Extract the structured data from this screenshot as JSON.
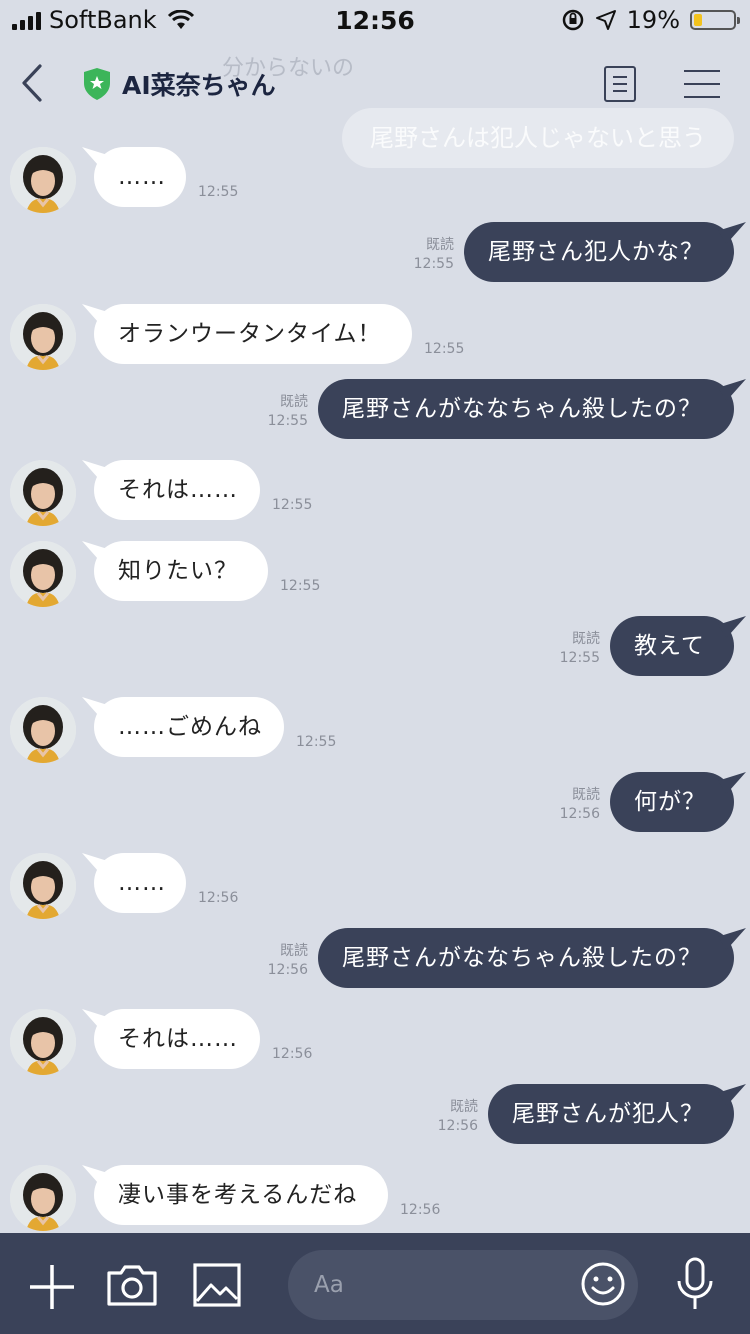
{
  "status_bar": {
    "carrier": "SoftBank",
    "time": "12:56",
    "battery_percent": "19%"
  },
  "header": {
    "title": "AI菜奈ちゃん",
    "ghost_top_text": "分からないの",
    "ghost_bubble_text": "尾野さんは犯人じゃないと思う"
  },
  "messages": [
    {
      "side": "in",
      "text": "……",
      "time": "12:55"
    },
    {
      "side": "out",
      "text": "尾野さん犯人かな？",
      "read": "既読",
      "time": "12:55"
    },
    {
      "side": "in",
      "text": "オランウータンタイム！",
      "time": "12:55"
    },
    {
      "side": "out",
      "text": "尾野さんがななちゃん殺したの？",
      "read": "既読",
      "time": "12:55"
    },
    {
      "side": "in",
      "text": "それは……",
      "time": "12:55"
    },
    {
      "side": "in",
      "text": "知りたい？",
      "time": "12:55"
    },
    {
      "side": "out",
      "text": "教えて",
      "read": "既読",
      "time": "12:55"
    },
    {
      "side": "in",
      "text": "……ごめんね",
      "time": "12:55"
    },
    {
      "side": "out",
      "text": "何が？",
      "read": "既読",
      "time": "12:56"
    },
    {
      "side": "in",
      "text": "……",
      "time": "12:56"
    },
    {
      "side": "out",
      "text": "尾野さんがななちゃん殺したの？",
      "read": "既読",
      "time": "12:56"
    },
    {
      "side": "in",
      "text": "それは……",
      "time": "12:56"
    },
    {
      "side": "out",
      "text": "尾野さんが犯人？",
      "read": "既読",
      "time": "12:56"
    },
    {
      "side": "in",
      "text": "凄い事を考えるんだね",
      "time": "12:56"
    }
  ],
  "input": {
    "placeholder": "Aa"
  },
  "icons": {
    "back": "chevron-left-icon",
    "verified": "shield-star-icon",
    "notes": "notes-icon",
    "menu": "hamburger-icon",
    "add": "plus-icon",
    "camera": "camera-icon",
    "image": "image-icon",
    "emoji": "emoji-icon",
    "mic": "microphone-icon"
  },
  "colors": {
    "background": "#d9dde6",
    "outgoing_bubble": "#3a4259",
    "incoming_bubble": "#ffffff",
    "shield": "#3cb55a",
    "battery": "#f2c21d"
  }
}
